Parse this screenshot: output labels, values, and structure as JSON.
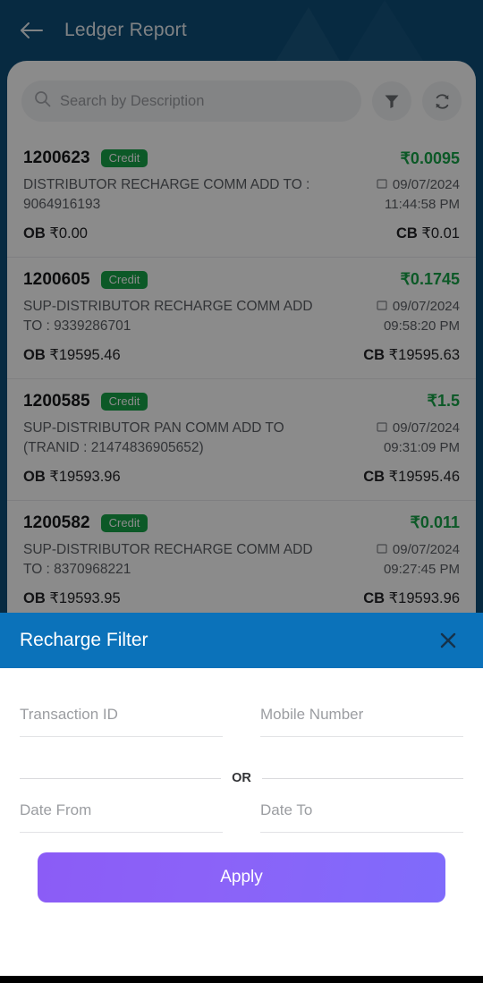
{
  "colors": {
    "appbar_bg": "#0d4d78",
    "sheet_header_bg": "#0b72ba",
    "credit_badge": "#17a348",
    "credit_amount": "#17a348",
    "apply_gradient_start": "#8b5cf6",
    "apply_gradient_end": "#7f6bfb"
  },
  "appbar": {
    "back_icon": "arrow-left-icon",
    "title": "Ledger Report"
  },
  "search": {
    "icon": "search-icon",
    "placeholder": "Search by Description",
    "value": "",
    "filter_icon": "funnel-icon",
    "refresh_icon": "refresh-icon"
  },
  "transactions": [
    {
      "id": "1200623",
      "type": "Credit",
      "amount": "₹0.0095",
      "description": "DISTRIBUTOR RECHARGE COMM ADD TO : 9064916193",
      "date": "09/07/2024",
      "time": "11:44:58 PM",
      "ob_label": "OB",
      "ob_value": "₹0.00",
      "cb_label": "CB",
      "cb_value": "₹0.01"
    },
    {
      "id": "1200605",
      "type": "Credit",
      "amount": "₹0.1745",
      "description": "SUP-DISTRIBUTOR RECHARGE COMM ADD TO : 9339286701",
      "date": "09/07/2024",
      "time": "09:58:20 PM",
      "ob_label": "OB",
      "ob_value": "₹19595.46",
      "cb_label": "CB",
      "cb_value": "₹19595.63"
    },
    {
      "id": "1200585",
      "type": "Credit",
      "amount": "₹1.5",
      "description": "SUP-DISTRIBUTOR PAN COMM ADD TO (TRANID : 21474836905652)",
      "date": "09/07/2024",
      "time": "09:31:09 PM",
      "ob_label": "OB",
      "ob_value": "₹19593.96",
      "cb_label": "CB",
      "cb_value": "₹19595.46"
    },
    {
      "id": "1200582",
      "type": "Credit",
      "amount": "₹0.011",
      "description": "SUP-DISTRIBUTOR RECHARGE COMM ADD TO : 8370968221",
      "date": "09/07/2024",
      "time": "09:27:45 PM",
      "ob_label": "OB",
      "ob_value": "₹19593.95",
      "cb_label": "CB",
      "cb_value": "₹19593.96"
    }
  ],
  "filter_sheet": {
    "title": "Recharge Filter",
    "close_icon": "close-icon",
    "fields": {
      "transaction_id": {
        "label": "Transaction ID",
        "value": ""
      },
      "mobile_number": {
        "label": "Mobile Number",
        "value": ""
      },
      "date_from": {
        "label": "Date From",
        "value": ""
      },
      "date_to": {
        "label": "Date To",
        "value": ""
      }
    },
    "or_text": "OR",
    "apply_label": "Apply"
  }
}
